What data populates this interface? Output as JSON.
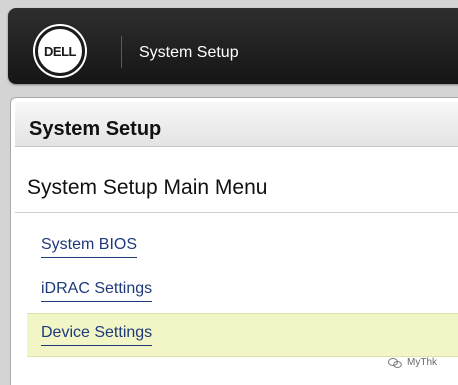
{
  "header": {
    "logo_text": "DELL",
    "app_title": "System Setup"
  },
  "panel": {
    "title": "System Setup",
    "menu_title": "System Setup Main Menu",
    "items": [
      {
        "label": "System BIOS",
        "selected": false
      },
      {
        "label": "iDRAC Settings",
        "selected": false
      },
      {
        "label": "Device Settings",
        "selected": true
      }
    ]
  },
  "watermark": {
    "text": "MyThk"
  },
  "colors": {
    "link": "#1f3a7a",
    "selected_bg": "#f2f5c6",
    "topbar": "#1e1e1e"
  }
}
